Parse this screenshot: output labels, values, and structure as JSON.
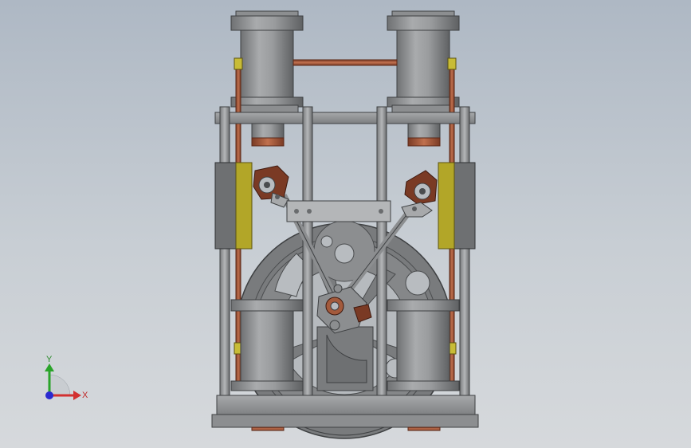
{
  "triad": {
    "y_label": "Y",
    "x_label": "X",
    "y_color": "#2aa42a",
    "x_color": "#d23030",
    "z_color": "#2a2ad0"
  },
  "model": {
    "background_top": "#aeb8c4",
    "background_bottom": "#d6d9dc",
    "metal_color": "#8f9193",
    "pipe_color": "#a35a3c",
    "pad_color": "#b2a628",
    "block_color": "#6e7072"
  }
}
